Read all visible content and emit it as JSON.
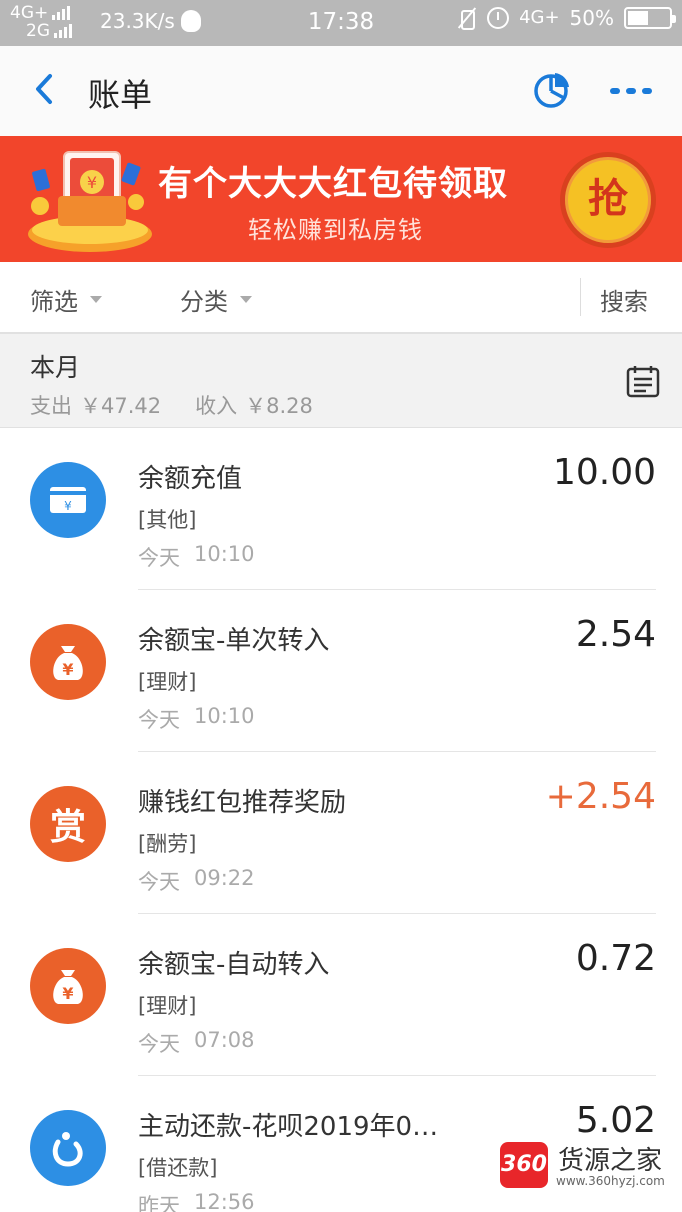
{
  "status_bar": {
    "net_top": "4G+",
    "net_bottom": "2G",
    "speed": "23.3K/s",
    "time": "17:38",
    "net_right": "4G+",
    "battery": "50%",
    "battery_level": 0.5
  },
  "header": {
    "title": "账单",
    "back_icon": "back-arrow-icon",
    "chart_icon": "pie-chart-icon",
    "more_icon": "more-dots-icon",
    "accent_color": "#1a7ad9"
  },
  "banner": {
    "title": "有个大大大红包待领取",
    "subtitle": "轻松赚到私房钱",
    "button_label": "抢",
    "bg_color": "#f2452b"
  },
  "filters": {
    "filter_label": "筛选",
    "category_label": "分类",
    "search_label": "搜索"
  },
  "month": {
    "title": "本月",
    "expense_label": "支出",
    "expense_value": "￥47.42",
    "income_label": "收入",
    "income_value": "￥8.28",
    "calendar_icon": "calendar-icon"
  },
  "items": [
    {
      "name": "余额充值",
      "category": "[其他]",
      "day": "今天",
      "time": "10:10",
      "amount": "10.00",
      "icon": "card-icon",
      "kind": "expense"
    },
    {
      "name": "余额宝-单次转入",
      "category": "[理财]",
      "day": "今天",
      "time": "10:10",
      "amount": "2.54",
      "icon": "money-bag-icon",
      "kind": "expense"
    },
    {
      "name": "赚钱红包推荐奖励",
      "category": "[酬劳]",
      "day": "今天",
      "time": "09:22",
      "amount": "+2.54",
      "icon": "reward-icon",
      "icon_text": "赏",
      "kind": "income"
    },
    {
      "name": "余额宝-自动转入",
      "category": "[理财]",
      "day": "今天",
      "time": "07:08",
      "amount": "0.72",
      "icon": "money-bag-icon",
      "kind": "expense"
    },
    {
      "name": "主动还款-花呗2019年0…",
      "category": "[借还款]",
      "day": "昨天",
      "time": "12:56",
      "amount": "5.02",
      "icon": "huabei-icon",
      "kind": "expense"
    }
  ],
  "watermark": {
    "logo": "360",
    "text": "货源之家",
    "url": "www.360hyzj.com"
  }
}
